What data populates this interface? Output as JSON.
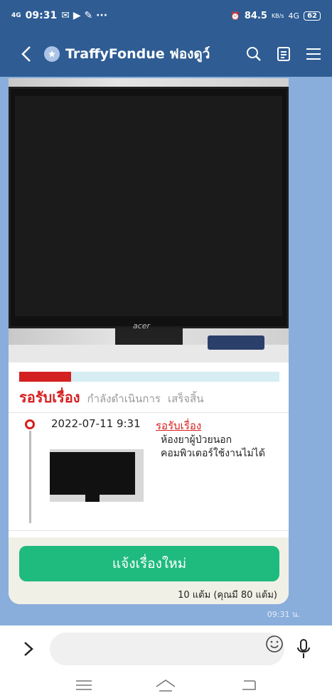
{
  "status_bar": {
    "network_left": "4G",
    "time": "09:31",
    "network_speed": "84.5",
    "network_unit": "KB/s",
    "network_right": "4G",
    "battery": "62"
  },
  "header": {
    "title": "TraffyFondue ฟองดูว์"
  },
  "report": {
    "progress_fraction": 0.2,
    "steps": {
      "active": "รอรับเรื่อง",
      "in_progress": "กำลังดำเนินการ",
      "done": "เสร็จสิ้น"
    },
    "timeline": {
      "datetime": "2022-07-11 9:31",
      "status": "รอรับเรื่อง",
      "description": "ห้องยาผู้ป่วยนอก คอมพิวเตอร์ใช้งานไม่ได้"
    },
    "photo_brand": "acer"
  },
  "actions": {
    "new_report_label": "แจ้งเรื่องใหม่",
    "points_text": "10 แต้ม (คุณมี 80 แต้ม)"
  },
  "chat": {
    "message_time": "09:31 น.",
    "input_placeholder": ""
  },
  "colors": {
    "header_bg": "#2e5c93",
    "accent_red": "#d62020",
    "button_green": "#1fba7e",
    "chat_bg": "#8aaedb"
  }
}
